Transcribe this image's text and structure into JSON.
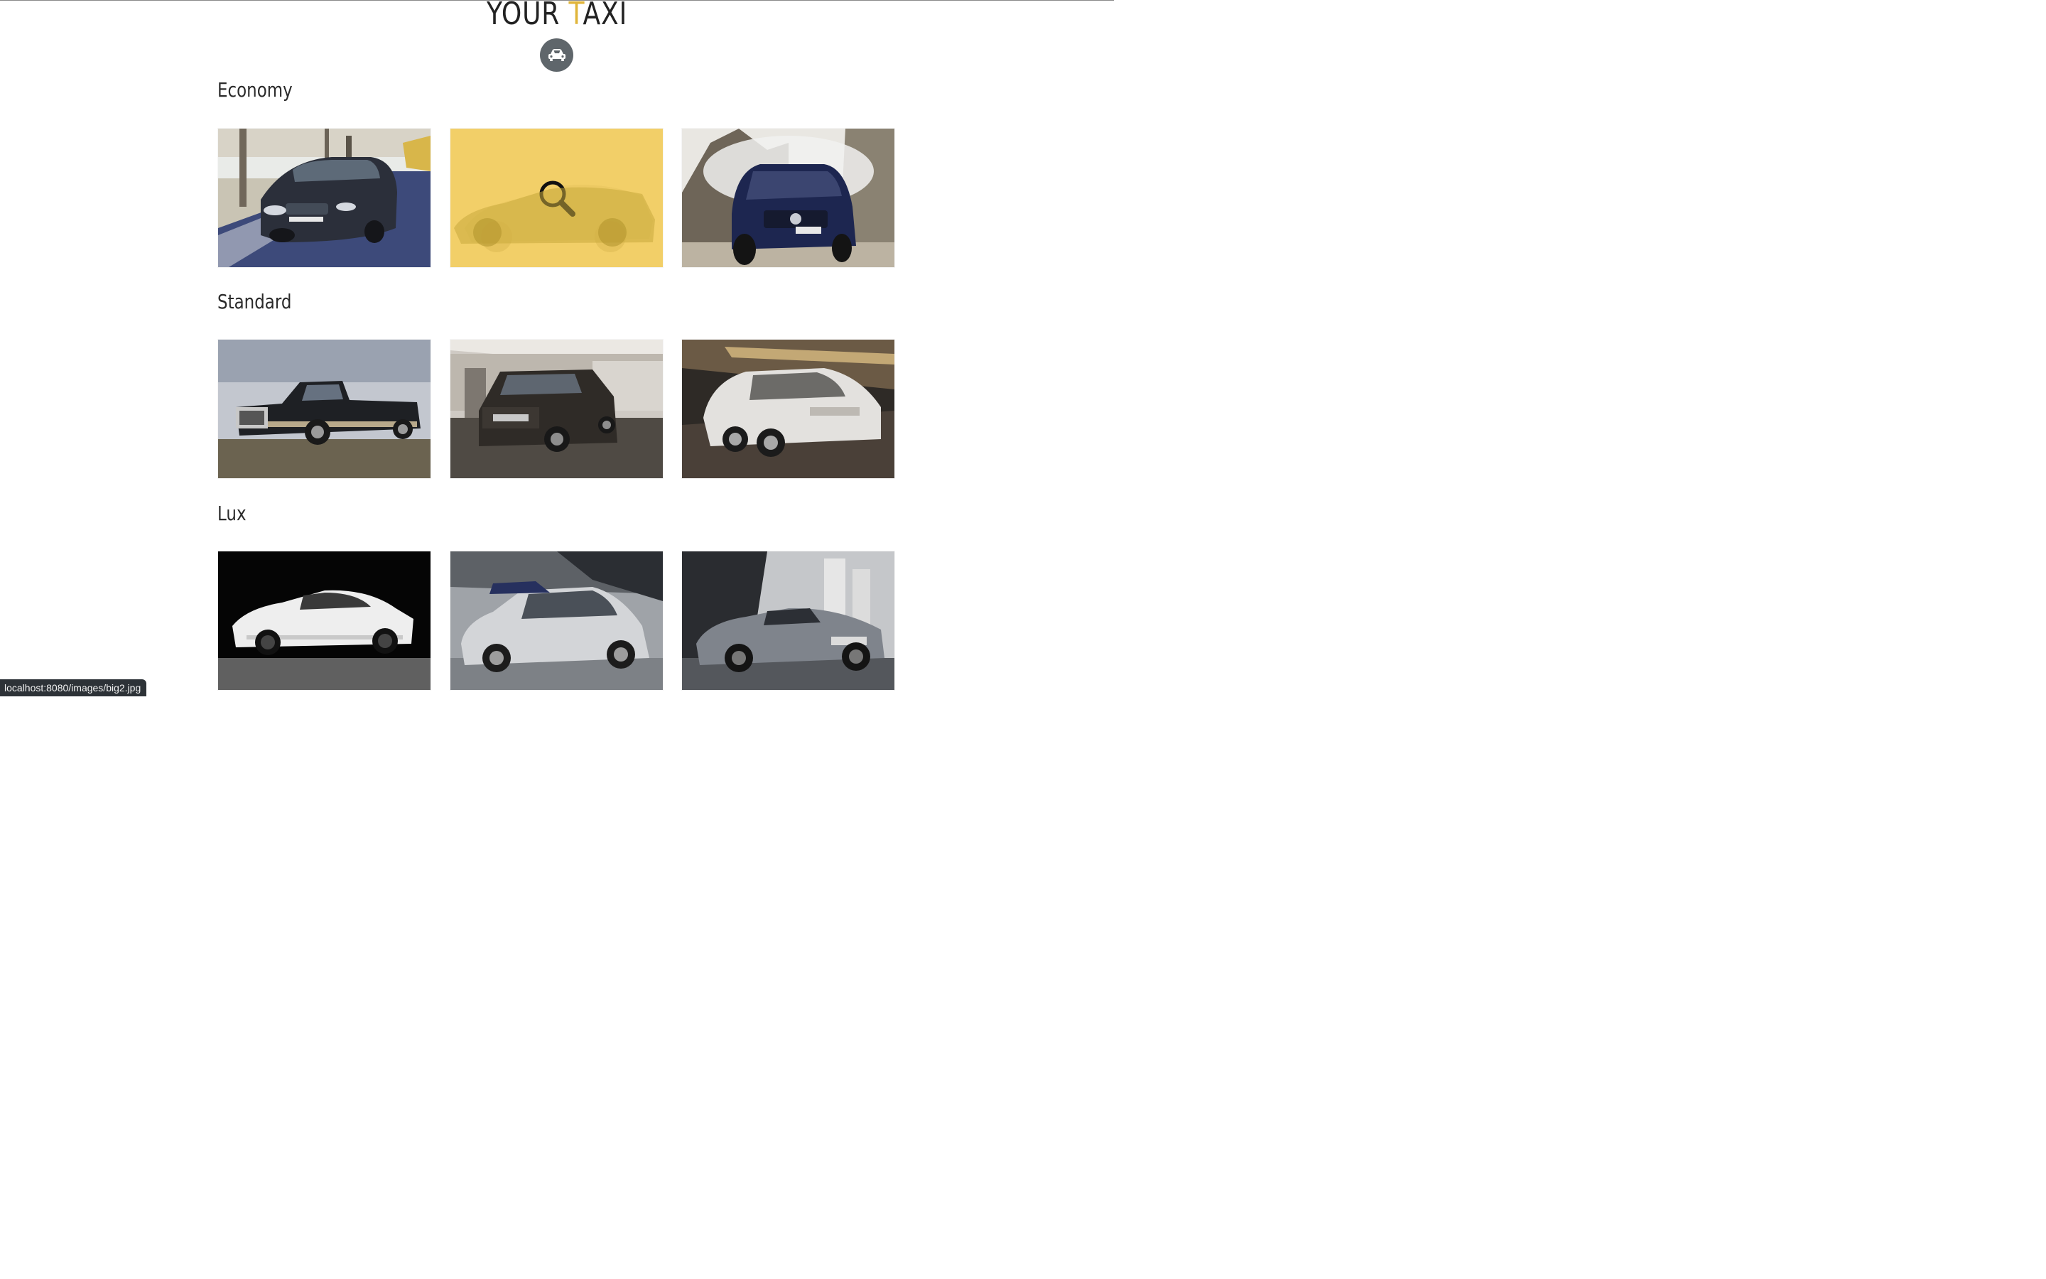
{
  "header": {
    "title_prefix": "YOUR ",
    "title_accent": "T",
    "title_suffix": "AXI",
    "logo_icon": "car-icon",
    "accent_color": "#e0b53a"
  },
  "sections": [
    {
      "heading": "Economy",
      "cars": [
        "bmw-wagon",
        "wagon-hover",
        "mercedes-suv"
      ]
    },
    {
      "heading": "Standard",
      "cars": [
        "pickup-truck",
        "land-rover-suv",
        "mercedes-sedan"
      ]
    },
    {
      "heading": "Lux",
      "cars": [
        "bmw-coupe",
        "citroen-hatchback",
        "bmw-i8-roadster"
      ]
    }
  ],
  "hover_overlay": {
    "icon": "magnifier-icon",
    "color": "#f3ce5f"
  },
  "status_bar": {
    "url": "localhost:8080/images/big2.jpg"
  }
}
